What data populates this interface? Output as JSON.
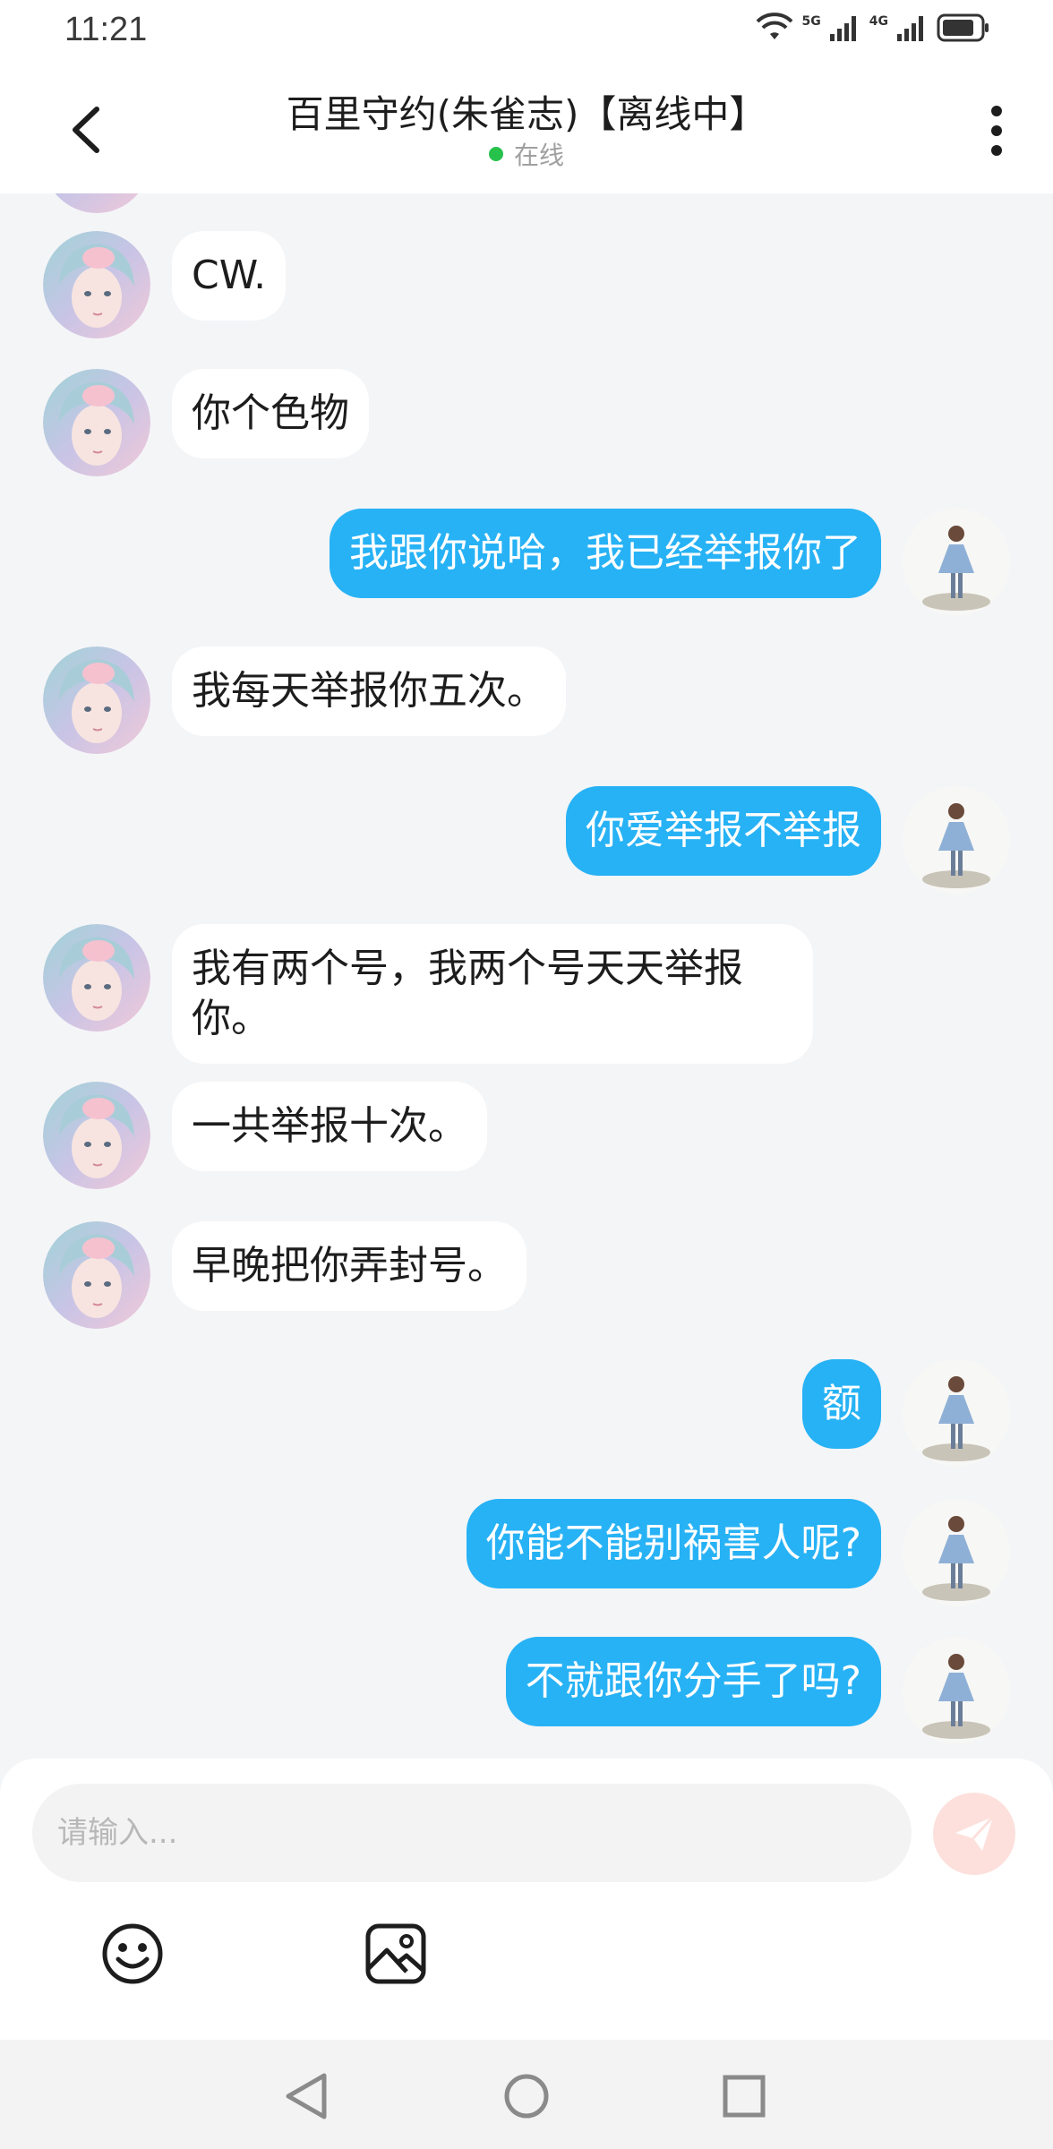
{
  "status_bar": {
    "time": "11:21",
    "network_1": "5G",
    "network_2": "4G"
  },
  "header": {
    "title": "百里守约(朱雀志)【离线中】",
    "status": "在线",
    "status_color": "#27c24c"
  },
  "messages": [
    {
      "side": "left",
      "text": "CW."
    },
    {
      "side": "left",
      "text": "你个色物"
    },
    {
      "side": "right",
      "text": "我跟你说哈，我已经举报你了"
    },
    {
      "side": "left",
      "text": "我每天举报你五次。"
    },
    {
      "side": "right",
      "text": "你爱举报不举报"
    },
    {
      "side": "left",
      "text": "我有两个号，我两个号天天举报你。"
    },
    {
      "side": "left",
      "text": "一共举报十次。"
    },
    {
      "side": "left",
      "text": "早晚把你弄封号。"
    },
    {
      "side": "right",
      "text": "额"
    },
    {
      "side": "right",
      "text": "你能不能别祸害人呢?"
    },
    {
      "side": "right",
      "text": "不就跟你分手了吗?"
    }
  ],
  "input": {
    "placeholder": "请输入..."
  },
  "colors": {
    "accent_blue": "#27b2f5",
    "send_button": "#fde0dc"
  },
  "icons": {
    "back": "back-arrow-icon",
    "more": "more-vertical-icon",
    "send": "send-icon",
    "emoji": "emoji-icon",
    "image": "image-icon",
    "nav_back": "nav-back-icon",
    "nav_home": "nav-home-icon",
    "nav_recent": "nav-recent-icon"
  }
}
